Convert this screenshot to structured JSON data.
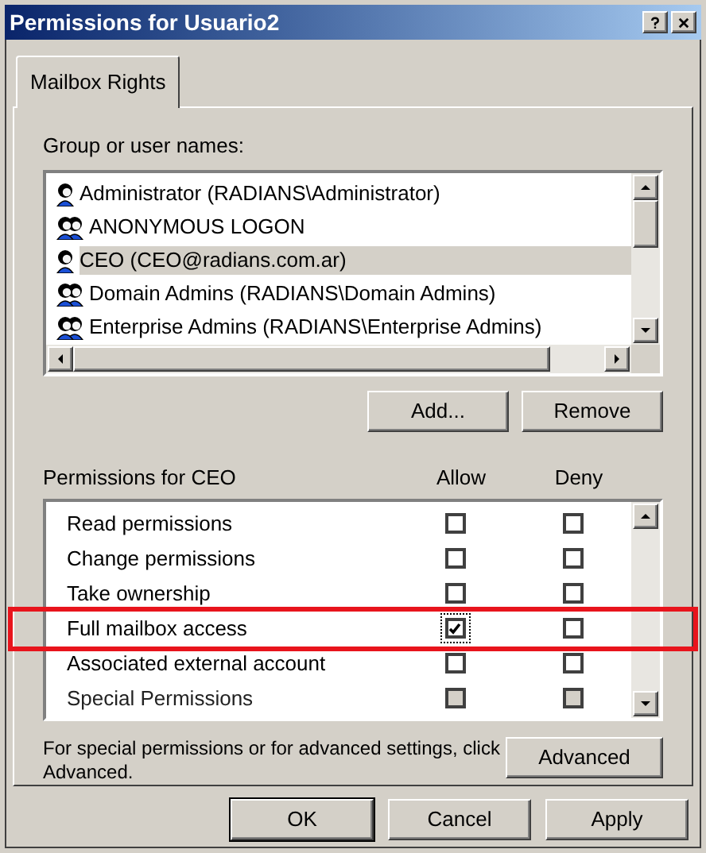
{
  "window": {
    "title": "Permissions for Usuario2"
  },
  "tabs": [
    {
      "label": "Mailbox Rights",
      "selected": true
    }
  ],
  "users": {
    "label": "Group or user names:",
    "items": [
      {
        "name": "Administrator (RADIANS\\Administrator)",
        "kind": "user",
        "selected": false
      },
      {
        "name": "ANONYMOUS LOGON",
        "kind": "group",
        "selected": false
      },
      {
        "name": "CEO (CEO@radians.com.ar)",
        "kind": "user",
        "selected": true
      },
      {
        "name": "Domain Admins (RADIANS\\Domain Admins)",
        "kind": "group",
        "selected": false
      },
      {
        "name": "Enterprise Admins (RADIANS\\Enterprise Admins)",
        "kind": "group",
        "selected": false
      }
    ]
  },
  "user_buttons": [
    "Add...",
    "Remove"
  ],
  "permissions": {
    "label": "Permissions for CEO",
    "columns": [
      "Allow",
      "Deny"
    ],
    "items": [
      {
        "name": "Read permissions",
        "allow": false,
        "deny": false,
        "disabled": false,
        "highlighted": false
      },
      {
        "name": "Change permissions",
        "allow": false,
        "deny": false,
        "disabled": false,
        "highlighted": false
      },
      {
        "name": "Take ownership",
        "allow": false,
        "deny": false,
        "disabled": false,
        "highlighted": false
      },
      {
        "name": "Full mailbox access",
        "allow": true,
        "deny": false,
        "disabled": false,
        "highlighted": true
      },
      {
        "name": "Associated external account",
        "allow": false,
        "deny": false,
        "disabled": false,
        "highlighted": false
      },
      {
        "name": "Special Permissions",
        "allow": false,
        "deny": false,
        "disabled": true,
        "highlighted": false
      }
    ]
  },
  "advanced": {
    "text": "For special permissions or for advanced settings, click Advanced.",
    "button": "Advanced"
  },
  "buttons": [
    "OK",
    "Cancel",
    "Apply"
  ]
}
